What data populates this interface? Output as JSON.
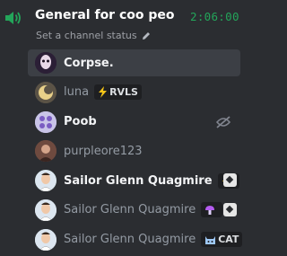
{
  "channel": {
    "name": "General for coo peo...",
    "timer": "2:06:00",
    "status_placeholder": "Set a channel status"
  },
  "users": [
    {
      "name": "Corpse.",
      "active": true,
      "style": "bright",
      "avatar_color": "#2b1f36",
      "avatar_icon": "corpse-avatar"
    },
    {
      "name": "luna",
      "style": "dim",
      "tag": {
        "icon": "lightning-icon",
        "text": "RVLS"
      },
      "avatar_color": "#5b5346",
      "avatar_icon": "luna-avatar"
    },
    {
      "name": "Poob",
      "style": "bright",
      "right_icon": "muted-stream-icon",
      "avatar_color": "#c9c4e8",
      "avatar_icon": "poob-avatar"
    },
    {
      "name": "purpleore123",
      "style": "dim",
      "avatar_color": "#6e4a3f",
      "avatar_icon": "purpleore-avatar"
    },
    {
      "name": "Sailor Glenn Quagmire",
      "style": "bright",
      "tag": {
        "icon": "lightning-icon",
        "text": ""
      },
      "right_icon": "live-icon",
      "avatar_color": "#3f6b4a",
      "avatar_icon": "quagmire-avatar"
    },
    {
      "name": "Sailor Glenn Quagmire",
      "style": "dim",
      "tag": {
        "icon": "mushroom-icon",
        "text": ""
      },
      "right_icon": "live-icon",
      "avatar_color": "#dce6f0",
      "avatar_icon": "quagmire-avatar"
    },
    {
      "name": "Sailor Glenn Quagmire",
      "style": "dim",
      "tag": {
        "icon": "cat-icon",
        "text": "CAT"
      },
      "avatar_color": "#dce6f0",
      "avatar_icon": "quagmire-avatar"
    }
  ],
  "colors": {
    "background": "#2b2d31",
    "active_row": "#3c3f45",
    "timer_green": "#23a55a",
    "tag_bg": "#1e1f22"
  }
}
